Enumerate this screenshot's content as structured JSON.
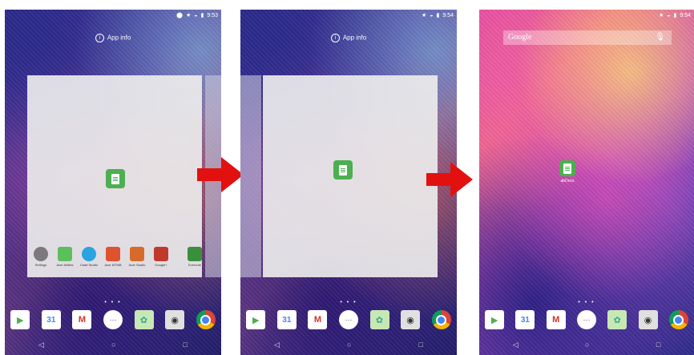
{
  "screen1": {
    "status_time": "9:53",
    "app_info_label": "App info",
    "page_indicator": "• • •",
    "mini_apps": [
      "Settings",
      "Acer Abfiles",
      "Chart Studio",
      "Acer MTMB",
      "Acer Studio",
      "Google+",
      "Evernote"
    ]
  },
  "screen2": {
    "status_time": "9:54",
    "app_info_label": "App info",
    "page_indicator": "• • •"
  },
  "screen3": {
    "status_time": "9:54",
    "search_logo": "Google",
    "shortcut_label": "abDocs",
    "page_indicator": "• • •"
  },
  "dock": {
    "calendar_day": "31",
    "icons": [
      "play-store-icon",
      "calendar-icon",
      "gmail-icon",
      "app-drawer-icon",
      "gallery-icon",
      "camera-icon",
      "chrome-icon"
    ]
  },
  "nav": {
    "back": "◁",
    "home": "○",
    "recents": "□"
  },
  "colors": {
    "accent_arrow": "#e31010",
    "docs_green": "#4caf50"
  }
}
